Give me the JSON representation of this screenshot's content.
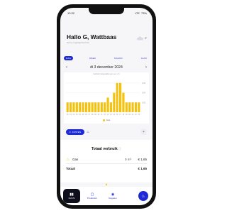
{
  "status": {
    "time": "13:32",
    "signal": "LTE",
    "battery": "73%"
  },
  "header": {
    "greeting": "Hallo G, Wattbaas",
    "subtitle": "Heb je ingelogd bij Flow",
    "weather": {
      "icon": "cloud-icon",
      "temp": "5°"
    }
  },
  "periods": [
    "DAG",
    "WEEK",
    "MAAND",
    "JAAR"
  ],
  "active_period": 0,
  "date_nav": {
    "date": "di 3 december 2024",
    "prev": "‹",
    "next": "›"
  },
  "chart_data": {
    "type": "bar",
    "caption": "Gebruik (uitgesplitst per uur, m³)",
    "categories": [
      "00",
      "01",
      "02",
      "03",
      "04",
      "05",
      "06",
      "07",
      "08",
      "09",
      "10",
      "11",
      "12",
      "13",
      "14",
      "15",
      "16",
      "17",
      "18",
      "19",
      "20",
      "21",
      "22",
      "23"
    ],
    "series": [
      {
        "name": "Gas",
        "values": [
          0.02,
          0.02,
          0.02,
          0.02,
          0.02,
          0.02,
          0.02,
          0.02,
          0.02,
          0.02,
          0.02,
          0.02,
          0.02,
          0.03,
          0.02,
          0.04,
          0.06,
          0.06,
          0.04,
          0.02,
          0.02,
          0.02,
          0.02,
          0.02
        ],
        "color": "#f4c20d"
      }
    ],
    "yticks": [
      "0,06",
      "0,04",
      "0,02"
    ],
    "ylim": [
      0,
      0.07
    ],
    "legend": "Gas"
  },
  "costs": {
    "label": "KOSTEN",
    "icon": "euro-icon",
    "toggle_icon": "flame-icon"
  },
  "summary": {
    "title": "Totaal verbruik",
    "info_icon": "ⓘ",
    "rows": [
      {
        "name": "Gas",
        "amount": "0 m³",
        "cost": "€ 1,65"
      }
    ],
    "total": {
      "name": "Totaal",
      "cost": "€ 1,65"
    }
  },
  "bottom_nav": [
    {
      "label": "Inzicht",
      "icon": "chart-icon",
      "glyph": "▮▮"
    },
    {
      "label": "Producten",
      "icon": "box-icon",
      "glyph": "▢"
    },
    {
      "label": "Regelen",
      "icon": "user-icon",
      "glyph": "◉"
    }
  ],
  "fab_icon": "flame-icon"
}
